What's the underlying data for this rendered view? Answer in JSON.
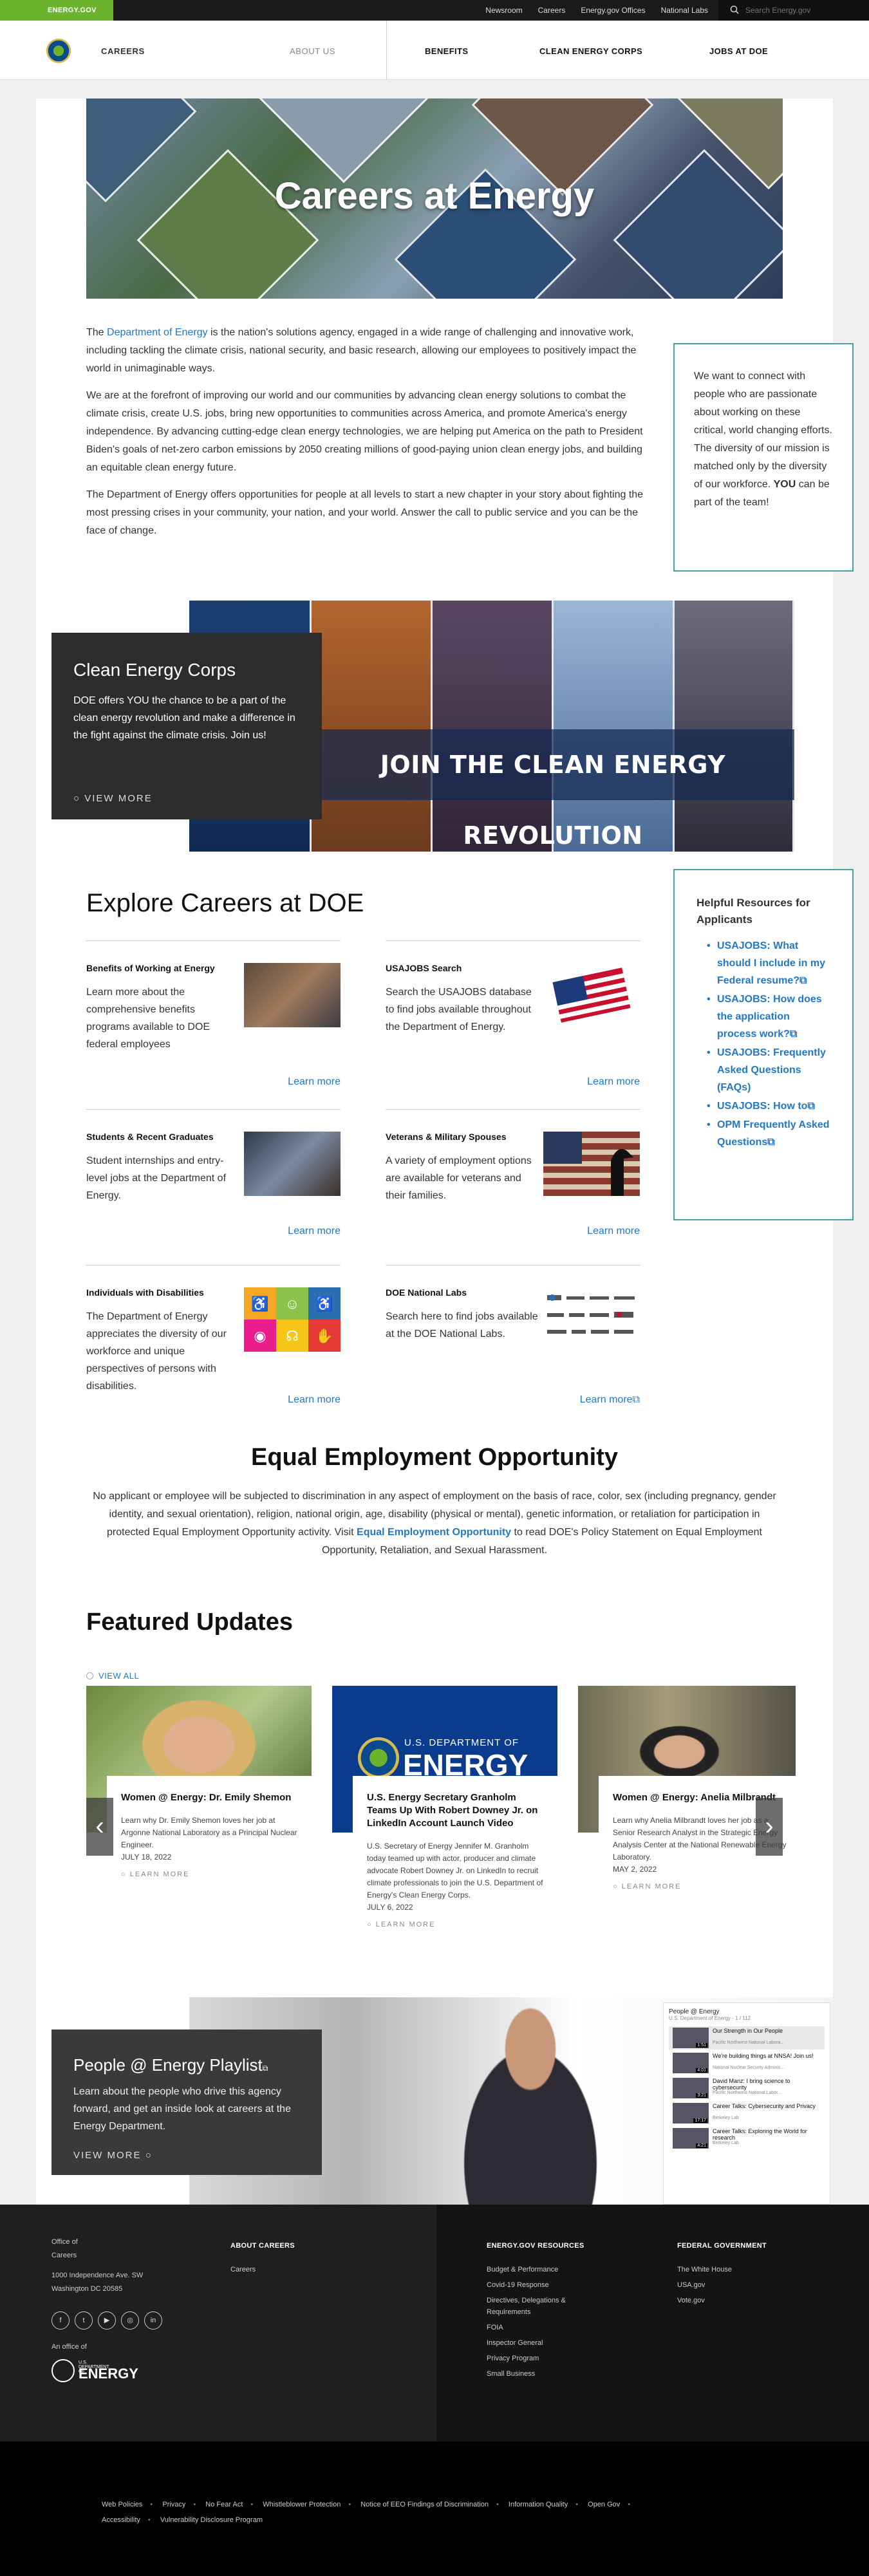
{
  "topbar": {
    "brand": "ENERGY.GOV",
    "links": [
      "Newsroom",
      "Careers",
      "Energy.gov Offices",
      "National Labs"
    ],
    "search_placeholder": "Search Energy.gov"
  },
  "nav": {
    "section": "CAREERS",
    "about": "ABOUT US",
    "items": [
      "BENEFITS",
      "CLEAN ENERGY CORPS",
      "JOBS AT DOE"
    ]
  },
  "hero": {
    "title": "Careers at Energy"
  },
  "intro": {
    "p1_pre": "The ",
    "p1_link": "Department of Energy",
    "p1_post": " is the nation's solutions agency, engaged in a wide range of challenging and innovative work, including tackling the climate crisis, national security, and basic research, allowing our employees to positively impact the world in unimaginable ways.",
    "p2": "We are at the forefront of improving our world and our communities by advancing  clean energy solutions to combat the climate crisis, create U.S. jobs, bring new opportunities to communities across America, and promote America's energy independence. By advancing cutting-edge clean energy technologies, we are helping put America on the path to President Biden's goals of net-zero carbon emissions by 2050  creating millions of good-paying union clean energy jobs, and building an equitable clean energy future.",
    "p3": "The Department of Energy offers opportunities for people at all levels to start a new chapter in your story about fighting the most pressing crises in your community, your nation, and your world. Answer the call to public service and you can be the face of change."
  },
  "callout": {
    "pre": "We want to connect with people who are passionate about working on these critical, world changing efforts. The diversity of our mission is matched only by the diversity of our workforce. ",
    "bold": "YOU",
    "post": " can be part of the team!"
  },
  "cec": {
    "banner": "JOIN THE CLEAN ENERGY REVOLUTION",
    "title": "Clean Energy Corps",
    "text": "DOE offers YOU the chance to be a part of the clean energy revolution and make a difference in the fight against the climate crisis. Join us!",
    "more": "VIEW MORE"
  },
  "explore": {
    "title": "Explore Careers at DOE",
    "cards": [
      {
        "title": "Benefits of Working at Energy",
        "text": "Learn more about the comprehensive benefits programs available to DOE federal employees",
        "link": "Learn more"
      },
      {
        "title": "USAJOBS Search",
        "text": "Search the USAJOBS database to find jobs available throughout the Department of Energy.",
        "link": "Learn more"
      },
      {
        "title": "Students & Recent Graduates",
        "text": "Student internships and entry-level jobs at the Department of Energy.",
        "link": "Learn more"
      },
      {
        "title": "Veterans & Military Spouses",
        "text": "A variety of employment options are available for veterans and their families.",
        "link": "Learn more"
      },
      {
        "title": "Individuals with Disabilities",
        "text": "The Department of Energy appreciates the diversity of our workforce and unique perspectives of persons with disabilities.",
        "link": "Learn more"
      },
      {
        "title": "DOE National Labs",
        "text": "Search here to find jobs available at the DOE National Labs.",
        "link": "Learn more"
      }
    ]
  },
  "resources": {
    "title": "Helpful Resources for Applicants",
    "items": [
      "USAJOBS: What should I include in my Federal resume?",
      "USAJOBS: How does the application process work?",
      "USAJOBS: Frequently Asked Questions (FAQs)",
      "USAJOBS: How to",
      "OPM Frequently Asked Questions"
    ]
  },
  "eeo": {
    "title": "Equal Employment Opportunity",
    "text_pre": "No applicant or employee will be subjected to discrimination in any aspect of employment on the basis of race, color, sex (including pregnancy, gender identity, and sexual orientation), religion, national origin, age, disability (physical or mental), genetic information, or retaliation for participation in protected Equal Employment Opportunity activity. Visit ",
    "link": "Equal Employment Opportunity",
    "text_post": " to read DOE's Policy Statement on Equal Employment Opportunity, Retaliation, and Sexual Harassment."
  },
  "featured": {
    "title": "Featured Updates",
    "view_all": "VIEW ALL",
    "cards": [
      {
        "title": "Women @ Energy: Dr. Emily Shemon",
        "text": "Learn why Dr. Emily Shemon loves her job at Argonne National Laboratory as a Principal Nuclear Engineer.",
        "date": "JULY 18, 2022",
        "more": "LEARN MORE"
      },
      {
        "title": "U.S. Energy Secretary Granholm Teams Up With Robert Downey Jr. on LinkedIn Account Launch Video",
        "text": "U.S. Secretary of Energy Jennifer M. Granholm today teamed up with actor, producer and climate advocate Robert Downey Jr. on LinkedIn to recruit climate professionals to join the U.S. Department of Energy's Clean Energy Corps.",
        "date": "JULY 6, 2022",
        "more": "LEARN MORE"
      },
      {
        "title": "Women @ Energy: Anelia Milbrandt",
        "text": "Learn why Anelia Milbrandt loves her job as a Senior Research Analyst in the Strategic Energy Analysis Center at the National Renewable Energy Laboratory.",
        "date": "MAY 2, 2022",
        "more": "LEARN MORE"
      }
    ],
    "doe_logo": {
      "top": "U.S. DEPARTMENT OF",
      "main": "ENERGY"
    }
  },
  "playlist": {
    "title": "People @ Energy Playlist",
    "text": "Learn about the people who drive this agency forward, and get an inside look at careers at the Energy Department.",
    "more": "VIEW MORE",
    "yt_title": "People @ Energy",
    "yt_sub": "U.S. Department of Energy - 1 / 112",
    "videos": [
      {
        "title": "Our Strength in Our People",
        "channel": "Pacific Northwest National Labora...",
        "dur": "1:51"
      },
      {
        "title": "We're building things at NNSA! Join us!",
        "channel": "National Nuclear Security Adminis...",
        "dur": "4:01"
      },
      {
        "title": "David Manz: I bring science to cybersecurity",
        "channel": "Pacific Northwest National Labor...",
        "dur": "3:21"
      },
      {
        "title": "Career Talks: Cybersecurity and Privacy",
        "channel": "Berkeley Lab",
        "dur": "17:17"
      },
      {
        "title": "Career Talks: Exploring the World for research",
        "channel": "Berkeley Lab",
        "dur": "4:21"
      }
    ]
  },
  "footer": {
    "office": "Office of Careers",
    "address1": "1000 Independence Ave. SW",
    "address2": "Washington DC 20585",
    "office_of": "An office of",
    "logo_top": "U.S. DEPARTMENT OF",
    "logo_main": "ENERGY",
    "about_title": "ABOUT CAREERS",
    "about_items": [
      "Careers"
    ],
    "res_title": "ENERGY.GOV RESOURCES",
    "res_items": [
      "Budget & Performance",
      "Covid-19 Response",
      "Directives, Delegations & Requirements",
      "FOIA",
      "Inspector General",
      "Privacy Program",
      "Small Business"
    ],
    "fed_title": "FEDERAL GOVERNMENT",
    "fed_items": [
      "The White House",
      "USA.gov",
      "Vote.gov"
    ],
    "social": [
      "f",
      "t",
      "▶",
      "◎",
      "in"
    ]
  },
  "subfooter": {
    "links": [
      "Web Policies",
      "Privacy",
      "No Fear Act",
      "Whistleblower Protection",
      "Notice of EEO Findings of Discrimination",
      "Information Quality",
      "Open Gov",
      "Accessibility",
      "Vulnerability Disclosure Program"
    ]
  },
  "colors": {
    "accent": "#2378c3",
    "brand_green": "#6cb32e",
    "teal_border": "#4aa1a3"
  }
}
